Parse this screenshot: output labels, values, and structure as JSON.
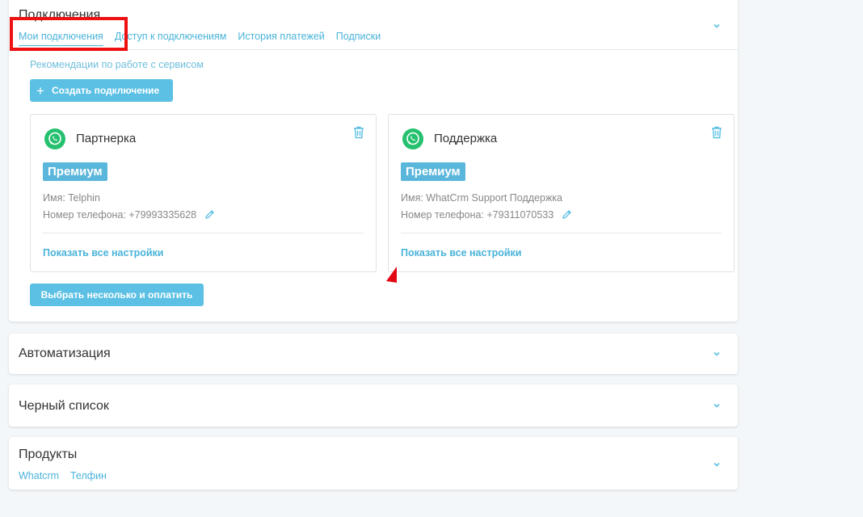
{
  "connections": {
    "title": "Подключения",
    "tabs": [
      {
        "label": "Мои подключения"
      },
      {
        "label": "Доступ к подключениям"
      },
      {
        "label": "История платежей"
      },
      {
        "label": "Подписки"
      }
    ],
    "recommendations_link": "Рекомендации по работе с сервисом",
    "create_button": "Создать подключение",
    "cards": [
      {
        "name": "Партнерка",
        "badge": "Премиум",
        "user_name": "Имя: Telphin",
        "phone": "Номер телефона: +79993335628",
        "settings_link": "Показать все настройки"
      },
      {
        "name": "Поддержка",
        "badge": "Премиум",
        "user_name": "Имя: WhatCrm Support Поддержка",
        "phone": "Номер телефона: +79311070533",
        "settings_link": "Показать все настройки"
      }
    ],
    "select_pay_button": "Выбрать несколько и оплатить"
  },
  "automation": {
    "title": "Автоматизация"
  },
  "blacklist": {
    "title": "Черный список"
  },
  "products": {
    "title": "Продукты",
    "links": [
      {
        "label": "Whatcrm"
      },
      {
        "label": "Телфин"
      }
    ]
  },
  "colors": {
    "accent": "#4ab3d9",
    "button": "#5bc0e4",
    "whatsapp": "#25c16f",
    "highlight": "#ee1111"
  },
  "icons": {
    "card_icon": "whatsapp-icon",
    "delete": "trash-icon",
    "edit": "pencil-icon",
    "expand": "chevron-down-icon",
    "create": "plus-icon"
  }
}
